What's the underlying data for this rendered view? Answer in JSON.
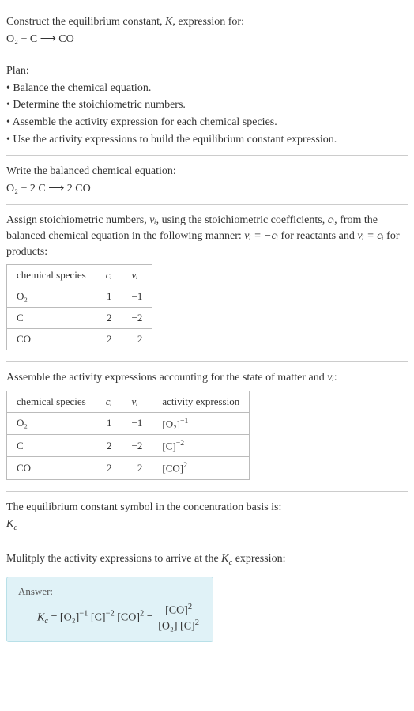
{
  "intro": {
    "line1": "Construct the equilibrium constant, ",
    "k": "K",
    "line1b": ", expression for:",
    "eq": "O₂ + C ⟶ CO"
  },
  "plan": {
    "title": "Plan:",
    "b1": "• Balance the chemical equation.",
    "b2": "• Determine the stoichiometric numbers.",
    "b3": "• Assemble the activity expression for each chemical species.",
    "b4": "• Use the activity expressions to build the equilibrium constant expression."
  },
  "balanced": {
    "title": "Write the balanced chemical equation:",
    "eq": "O₂ + 2 C ⟶ 2 CO"
  },
  "stoich": {
    "line1": "Assign stoichiometric numbers, ",
    "nu": "νᵢ",
    "line2": ", using the stoichiometric coefficients, ",
    "ci": "cᵢ",
    "line3": ", from the balanced chemical equation in the following manner: ",
    "rel1": "νᵢ = −cᵢ",
    "line4": " for reactants and ",
    "rel2": "νᵢ = cᵢ",
    "line5": " for products:",
    "headers": {
      "species": "chemical species",
      "ci": "cᵢ",
      "nu": "νᵢ"
    },
    "rows": [
      {
        "species": "O₂",
        "ci": "1",
        "nu": "−1"
      },
      {
        "species": "C",
        "ci": "2",
        "nu": "−2"
      },
      {
        "species": "CO",
        "ci": "2",
        "nu": "2"
      }
    ]
  },
  "activity": {
    "title": "Assemble the activity expressions accounting for the state of matter and ",
    "nu": "νᵢ",
    "title2": ":",
    "headers": {
      "species": "chemical species",
      "ci": "cᵢ",
      "nu": "νᵢ",
      "expr": "activity expression"
    },
    "rows": [
      {
        "species": "O₂",
        "ci": "1",
        "nu": "−1",
        "expr_base": "[O₂]",
        "expr_exp": "−1"
      },
      {
        "species": "C",
        "ci": "2",
        "nu": "−2",
        "expr_base": "[C]",
        "expr_exp": "−2"
      },
      {
        "species": "CO",
        "ci": "2",
        "nu": "2",
        "expr_base": "[CO]",
        "expr_exp": "2"
      }
    ]
  },
  "symbol": {
    "line": "The equilibrium constant symbol in the concentration basis is:",
    "kc": "K",
    "kcsub": "c"
  },
  "multiply": {
    "line": "Mulitply the activity expressions to arrive at the ",
    "kc": "K",
    "kcsub": "c",
    "line2": " expression:"
  },
  "answer": {
    "label": "Answer:",
    "lhs_k": "K",
    "lhs_sub": "c",
    "eq": " = ",
    "t1_base": "[O₂]",
    "t1_exp": "−1",
    "t2_base": "[C]",
    "t2_exp": "−2",
    "t3_base": "[CO]",
    "t3_exp": "2",
    "eq2": " = ",
    "frac_num_base": "[CO]",
    "frac_num_exp": "2",
    "frac_den1_base": "[O₂]",
    "frac_den2_base": "[C]",
    "frac_den2_exp": "2"
  }
}
